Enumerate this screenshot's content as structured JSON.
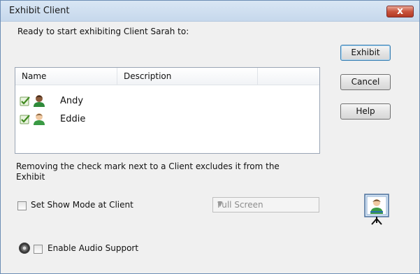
{
  "window": {
    "title": "Exhibit Client",
    "close_label": "x"
  },
  "intro_text": "Ready to start exhibiting Client Sarah to:",
  "list": {
    "columns": [
      "Name",
      "Description"
    ],
    "rows": [
      {
        "name": "Andy",
        "description": "",
        "checked": true
      },
      {
        "name": "Eddie",
        "description": "",
        "checked": true
      }
    ]
  },
  "buttons": {
    "exhibit": "Exhibit",
    "cancel": "Cancel",
    "help": "Help"
  },
  "note": {
    "line1": "Removing the check mark next to a Client excludes it from the",
    "line2": "Exhibit"
  },
  "show_mode": {
    "label": "Set Show Mode at Client",
    "checked": false,
    "select_value": "Full Screen"
  },
  "audio": {
    "label": "Enable Audio Support",
    "checked": false
  },
  "icons": {
    "close": "close-icon",
    "check": "check-icon",
    "person": "person-icon",
    "presenter": "presenter-screen-icon",
    "speaker": "speaker-icon",
    "dropdown": "chevron-down-icon"
  },
  "colors": {
    "close_button": "#c9533d",
    "titlebar": "#c6d8ec"
  }
}
